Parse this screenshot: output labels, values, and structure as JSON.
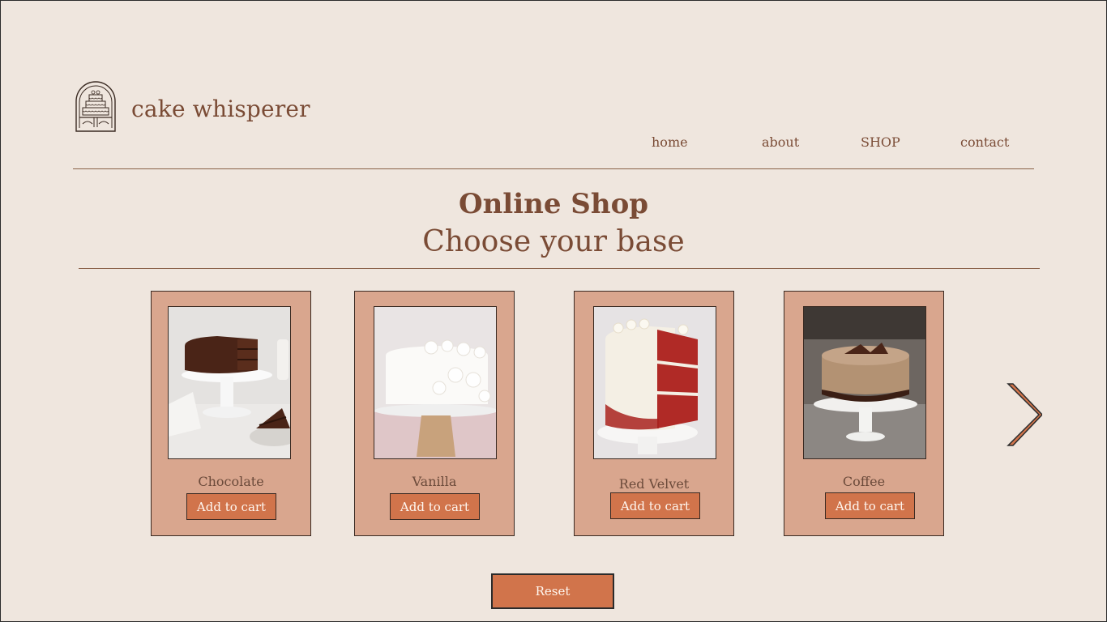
{
  "brand": {
    "name": "cake whisperer",
    "logo_icon": "cake-stand-arch-icon"
  },
  "nav": {
    "items": [
      "home",
      "about",
      "SHOP",
      "contact"
    ]
  },
  "page": {
    "title": "Online Shop",
    "subtitle": "Choose your base"
  },
  "products": [
    {
      "name": "Chocolate",
      "button": "Add to cart",
      "image_icon": "chocolate-cake-photo"
    },
    {
      "name": "Vanilla",
      "button": "Add to cart",
      "image_icon": "vanilla-cake-photo"
    },
    {
      "name": "Red Velvet",
      "button": "Add to cart",
      "image_icon": "red-velvet-cake-photo"
    },
    {
      "name": "Coffee",
      "button": "Add to cart",
      "image_icon": "coffee-cake-photo"
    }
  ],
  "carousel": {
    "next_icon": "chevron-right-icon"
  },
  "actions": {
    "reset_label": "Reset"
  },
  "colors": {
    "background": "#efe6de",
    "text": "#7a4b35",
    "card": "#d9a68e",
    "button": "#d1744b",
    "border": "#3a2a22"
  }
}
